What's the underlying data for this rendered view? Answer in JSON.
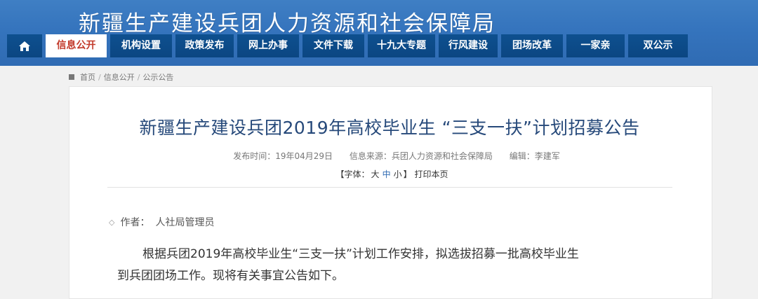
{
  "header": {
    "site_title": "新疆生产建设兵团人力资源和社会保障局"
  },
  "nav": {
    "home_icon": "home-icon",
    "items": [
      {
        "label": "信息公开",
        "active": true
      },
      {
        "label": "机构设置"
      },
      {
        "label": "政策发布"
      },
      {
        "label": "网上办事"
      },
      {
        "label": "文件下载"
      },
      {
        "label": "十九大专题"
      },
      {
        "label": "行风建设"
      },
      {
        "label": "团场改革"
      },
      {
        "label": "一家亲"
      },
      {
        "label": "双公示"
      }
    ]
  },
  "breadcrumb": {
    "home": "首页",
    "level1": "信息公开",
    "level2": "公示公告",
    "separator": "/"
  },
  "article": {
    "title": "新疆生产建设兵团2019年高校毕业生 “三支一扶”计划招募公告",
    "publish_time": "发布时间：19年04月29日",
    "source": "信息来源：兵团人力资源和社会保障局",
    "editor": "编辑：李建军",
    "font_prefix": "【字体：",
    "font_large": "大",
    "font_medium": "中",
    "font_small": "小",
    "font_suffix": "】",
    "print": "打印本页",
    "author_label": "作者：",
    "author_name": "人社局管理员",
    "body_line1": "根据兵团2019年高校毕业生“三支一扶”计划工作安排，拟选拔招募一批高校毕业生",
    "body_line2": "到兵团团场工作。现将有关事宜公告如下。"
  },
  "colors": {
    "header_blue": "#3574bd",
    "nav_dark": "#0b4682",
    "active_text": "#c23a2b",
    "title_blue": "#26497a"
  }
}
